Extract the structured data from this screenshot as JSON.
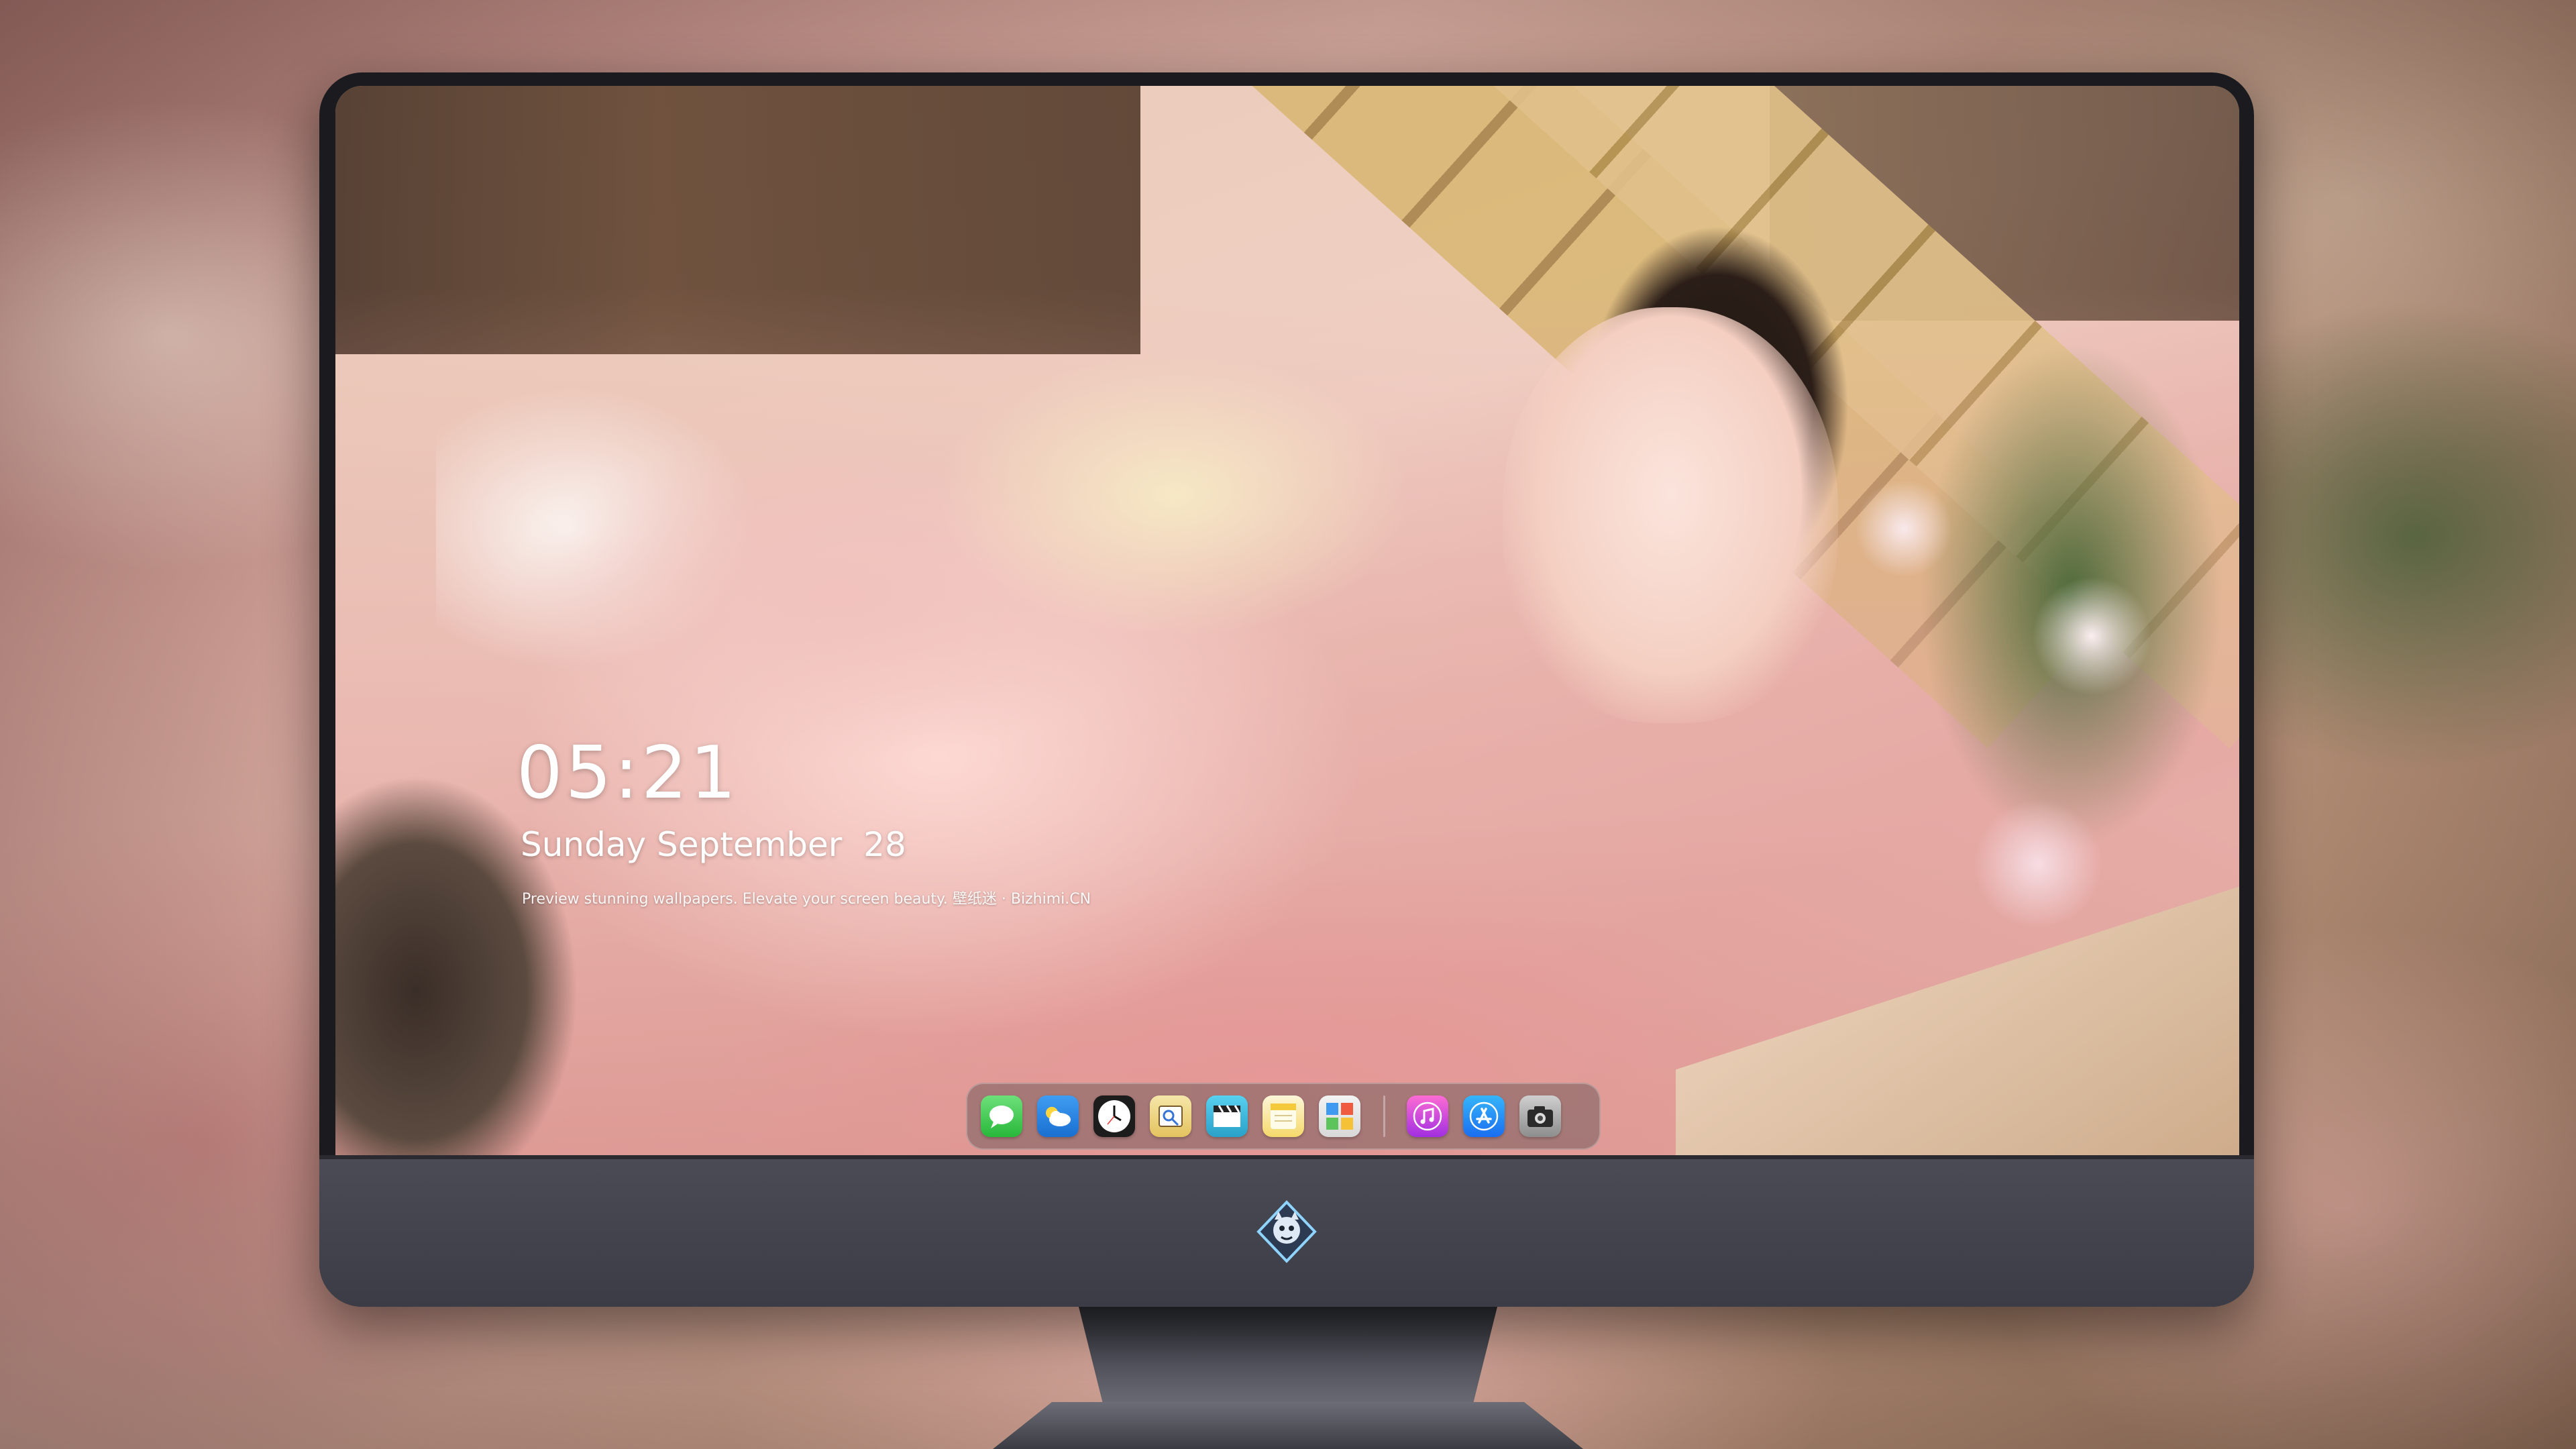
{
  "lockscreen": {
    "time": "05:21",
    "date": "Sunday September  28",
    "tagline": "Preview stunning wallpapers. Elevate your screen beauty. 壁纸迷 · Bizhimi.CN"
  },
  "dock": {
    "items": [
      {
        "icon": "messages-icon"
      },
      {
        "icon": "weather-icon"
      },
      {
        "icon": "clock-icon"
      },
      {
        "icon": "preview-icon"
      },
      {
        "icon": "video-icon"
      },
      {
        "icon": "notes-icon"
      },
      {
        "icon": "photos-icon"
      },
      {
        "icon": "music-icon"
      },
      {
        "icon": "app-store-icon"
      },
      {
        "icon": "camera-icon"
      }
    ]
  },
  "colors": {
    "monitor_bezel": "#1b1b1f",
    "monitor_chin": "#4a4b55",
    "text": "#ffffff"
  }
}
